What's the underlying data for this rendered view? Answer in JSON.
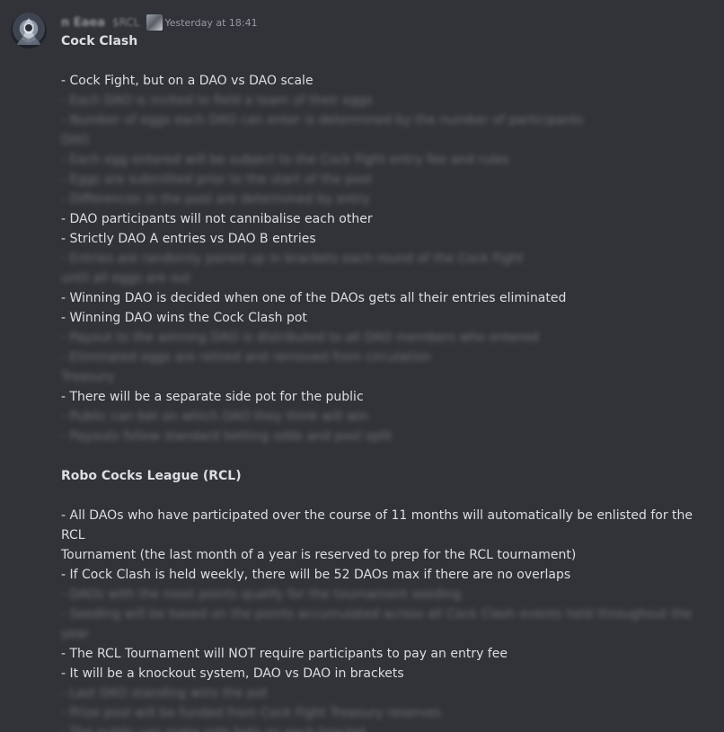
{
  "message": {
    "author": {
      "name": "n Eaea",
      "tag": "$RCL",
      "avatar_icon": "avatar-icon",
      "role_icon": "role-badge-icon"
    },
    "timestamp": "Yesterday at 18:41",
    "lines": [
      {
        "text": "Cock Clash",
        "style": "heading"
      },
      {
        "text": "",
        "style": "blank"
      },
      {
        "text": "- Cock Fight, but on a DAO vs DAO scale",
        "style": "text"
      },
      {
        "text": "- Each DAO is invited to field a team of their eggs",
        "style": "blurred"
      },
      {
        "text": "- Number of eggs each DAO can enter is determined by the number of participants",
        "style": "blurred"
      },
      {
        "text": "DAO",
        "style": "blurred"
      },
      {
        "text": "- Each egg entered will be subject to the Cock Fight entry fee and rules",
        "style": "blurred"
      },
      {
        "text": "- Eggs are submitted prior to the start of the pool",
        "style": "blurred"
      },
      {
        "text": "- Differences in the pool are determined by entry",
        "style": "blurred"
      },
      {
        "text": "- DAO participants will not cannibalise each other",
        "style": "text"
      },
      {
        "text": "- Strictly DAO A entries vs DAO B entries",
        "style": "text"
      },
      {
        "text": "- Entries are randomly paired up in brackets each round of the Cock Fight",
        "style": "blurred"
      },
      {
        "text": "until all eggs are out",
        "style": "blurred"
      },
      {
        "text": "- Winning DAO is decided when one of the DAOs gets all their entries eliminated",
        "style": "text"
      },
      {
        "text": "- Winning DAO wins the Cock Clash pot",
        "style": "text"
      },
      {
        "text": "- Payout to the winning DAO is distributed to all DAO members who entered",
        "style": "blurred"
      },
      {
        "text": "- Eliminated eggs are retired and removed from circulation",
        "style": "blurred"
      },
      {
        "text": "Treasury",
        "style": "blurred"
      },
      {
        "text": "- There will be a separate side pot for the public",
        "style": "text"
      },
      {
        "text": "- Public can bet on which DAO they think will win",
        "style": "blurred"
      },
      {
        "text": "- Payouts follow standard betting odds and pool split",
        "style": "blurred"
      },
      {
        "text": "",
        "style": "blank"
      },
      {
        "text": "Robo Cocks League (RCL)",
        "style": "heading"
      },
      {
        "text": "",
        "style": "blank"
      },
      {
        "text": "- All DAOs who have participated over the course of 11 months will automatically be enlisted for the RCL",
        "style": "text"
      },
      {
        "text": "Tournament (the last month of a year is reserved to prep for the RCL tournament)",
        "style": "text"
      },
      {
        "text": "- If Cock Clash is held weekly, there will be 52 DAOs max if there are no overlaps",
        "style": "text"
      },
      {
        "text": "- DAOs with the most points qualify for the tournament seeding",
        "style": "blurred"
      },
      {
        "text": "- Seeding will be based on the points accumulated across all Cock Clash events held throughout the",
        "style": "blurred"
      },
      {
        "text": "year",
        "style": "blurred"
      },
      {
        "text": "- The RCL Tournament will NOT require participants to pay an entry fee",
        "style": "text"
      },
      {
        "text": "- It will be a knockout system, DAO vs DAO in brackets",
        "style": "text"
      },
      {
        "text": "- Last DAO standing wins the pot",
        "style": "blurred"
      },
      {
        "text": "- Prize pool will be funded from Cock Fight Treasury reserves",
        "style": "blurred"
      },
      {
        "text": "- The public can make side bets on each bracket",
        "style": "blurred"
      }
    ]
  },
  "colors": {
    "background": "#313338",
    "text": "#dbdee1",
    "timestamp": "#949ba4"
  }
}
